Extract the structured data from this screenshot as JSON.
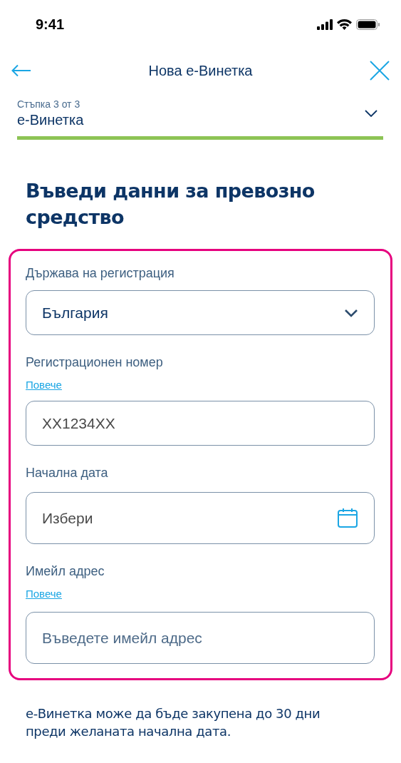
{
  "status_bar": {
    "time": "9:41"
  },
  "header": {
    "title": "Нова е-Винетка"
  },
  "step": {
    "label": "Стъпка 3 от 3",
    "name": "е-Винетка",
    "expanded": false,
    "level": 1
  },
  "heading": "Въведи данни за превозно средство",
  "form": {
    "fields": [
      {
        "kind": "select",
        "label": "Държава на регистрация",
        "value": "България"
      },
      {
        "kind": "text",
        "label": "Регистрационен номер",
        "link": "Повече",
        "placeholder": "XX1234XX"
      },
      {
        "kind": "date",
        "label": "Начална дата",
        "placeholder": "Избери"
      },
      {
        "kind": "email",
        "label": "Имейл адрес",
        "link": "Повече",
        "placeholder": "Въведете имейл адрес"
      }
    ]
  },
  "note": "е-Винетка може да бъде закупена до 30 дни преди желаната начална дата."
}
